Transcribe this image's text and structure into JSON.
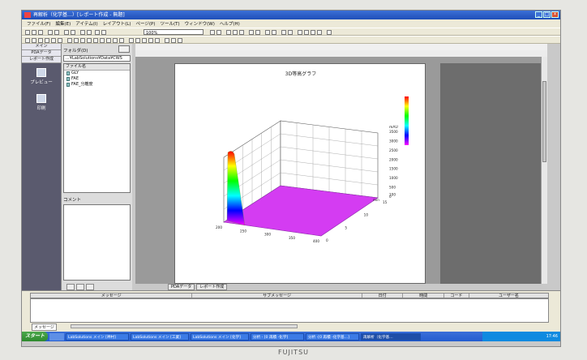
{
  "window": {
    "title": "再解析（化学基…）[レポート作成 - 無題]"
  },
  "menu": {
    "items": [
      "ファイル(F)",
      "編集(E)",
      "アイテム(I)",
      "レイアウト(L)",
      "ページ(P)",
      "ツール(T)",
      "ウィンドウ(W)",
      "ヘルプ(H)"
    ]
  },
  "toolbar": {
    "zoom_value": "100%"
  },
  "nav": {
    "tabs": [
      "メイン",
      "PDAデータ",
      "レポート作成"
    ],
    "items": [
      {
        "label": "プレビュー",
        "icon": "preview-icon"
      },
      {
        "label": "印刷",
        "icon": "print-icon"
      }
    ]
  },
  "file_panel": {
    "folder_label": "フォルダ(D)",
    "path": "...¥LabSolutions¥Data¥CWS",
    "list_header": "ファイル名",
    "files": [
      {
        "name": "GLY"
      },
      {
        "name": "FAE"
      },
      {
        "name": "FAE_分離度"
      }
    ],
    "comment_label": "コメント"
  },
  "report": {
    "tabs": [
      "PDAデータ",
      "レポート作成"
    ]
  },
  "chart_data": {
    "type": "surface-3d",
    "title": "3D等高グラフ",
    "x_ticks": [
      "200",
      "250",
      "300",
      "350",
      "400"
    ],
    "y_ticks": [
      "0",
      "5",
      "10",
      "15"
    ],
    "y_axis_label": "min",
    "z_ticks": [
      "0",
      "100",
      "500",
      "1000",
      "1500",
      "2000",
      "2500",
      "3000",
      "3500"
    ],
    "z_axis_label": "mAU",
    "peak": {
      "wavelength": 200,
      "time": 0.5,
      "absorbance": 3500
    },
    "colors": {
      "baseline": "#d43cf2",
      "colorbar": [
        "#ff0000",
        "#ffff00",
        "#00ff00",
        "#00ffff",
        "#0000ff",
        "#ff00ff"
      ]
    }
  },
  "message_panel": {
    "columns": [
      "メッセージ",
      "サブメッセージ",
      "日付",
      "時間",
      "コード",
      "ユーザー名"
    ],
    "tab": "メッセージ"
  },
  "taskbar": {
    "start": "スタート",
    "items": [
      "LabSolutions メイン [神村]",
      "LabSolutions メイン [工業]",
      "LabSolutions メイン [化学]",
      "分析 - [0 再積 -化学]",
      "分析 -[0 再積 -化学基…]",
      "再解析（化学基…"
    ],
    "clock": "17:46"
  },
  "brand": "FUJITSU"
}
